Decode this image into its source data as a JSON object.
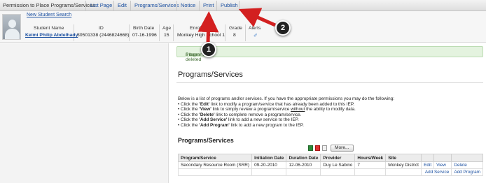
{
  "nav": {
    "title": "Permission to Place Programs/Services",
    "links": [
      "List Page",
      "Edit",
      "Programs/Services",
      "Notice",
      "Print",
      "Publish"
    ]
  },
  "student": {
    "new_search": "New Student Search",
    "headers": {
      "name": "Student Name",
      "id": "ID",
      "birth_date": "Birth Date",
      "age": "Age",
      "enrolled": "Enrolled",
      "grade": "Grade",
      "alerts": "Alerts"
    },
    "values": {
      "name": "Keimi Philip Abdelhady",
      "id": "30501338 (2446824668)",
      "birth_date": "07-16-1996",
      "age": "15",
      "enrolled": "Monkey High School 1",
      "grade": "8",
      "alerts_icon": "thumbtack-icon"
    }
  },
  "message": {
    "left": "Program",
    "right": "s been deleted"
  },
  "main": {
    "title": "Programs/Services",
    "intro": "Below is a list of programs and/or services. If you have the appropriate permissions you may do the following:",
    "bullets": [
      {
        "pre": "Click the ",
        "bold": "'Edit'",
        "post": " link to modify a program/service that has already been added to this IEP.",
        "u": "",
        "post2": ""
      },
      {
        "pre": "Click the ",
        "bold": "'View'",
        "post": " link to simply review a program/service ",
        "u": "without",
        "post2": " the ability to modify data."
      },
      {
        "pre": "Click the ",
        "bold": "'Delete'",
        "post": " link to complete remove a program/service.",
        "u": "",
        "post2": ""
      },
      {
        "pre": "Click the ",
        "bold": "'Add Service'",
        "post": " link to add a new service to the IEP.",
        "u": "",
        "post2": ""
      },
      {
        "pre": "Click the ",
        "bold": "'Add Program'",
        "post": " link to add a new program to the IEP.",
        "u": "",
        "post2": ""
      }
    ],
    "subtitle": "Programs/Services",
    "more_label": "More...",
    "tool_icons": [
      "excel-icon",
      "pdf-icon",
      "document-icon"
    ]
  },
  "table": {
    "headers": [
      "Program/Service",
      "Initiation Date",
      "Duration Date",
      "Provider",
      "Hours/Week",
      "Site",
      "",
      "",
      ""
    ],
    "row": {
      "program": "Secondary Resource Room (SRR)",
      "initiation": "09-20-2010",
      "duration": "12-06-2010",
      "provider": "Duy Le Sabino",
      "hours": "7",
      "site": "Monkey District",
      "edit": "Edit",
      "view": "View",
      "delete": "Delete"
    },
    "actions": {
      "add_service": "Add Service",
      "add_program": "Add Program"
    }
  },
  "callouts": {
    "one": "1",
    "two": "2",
    "color": "#d32020"
  }
}
